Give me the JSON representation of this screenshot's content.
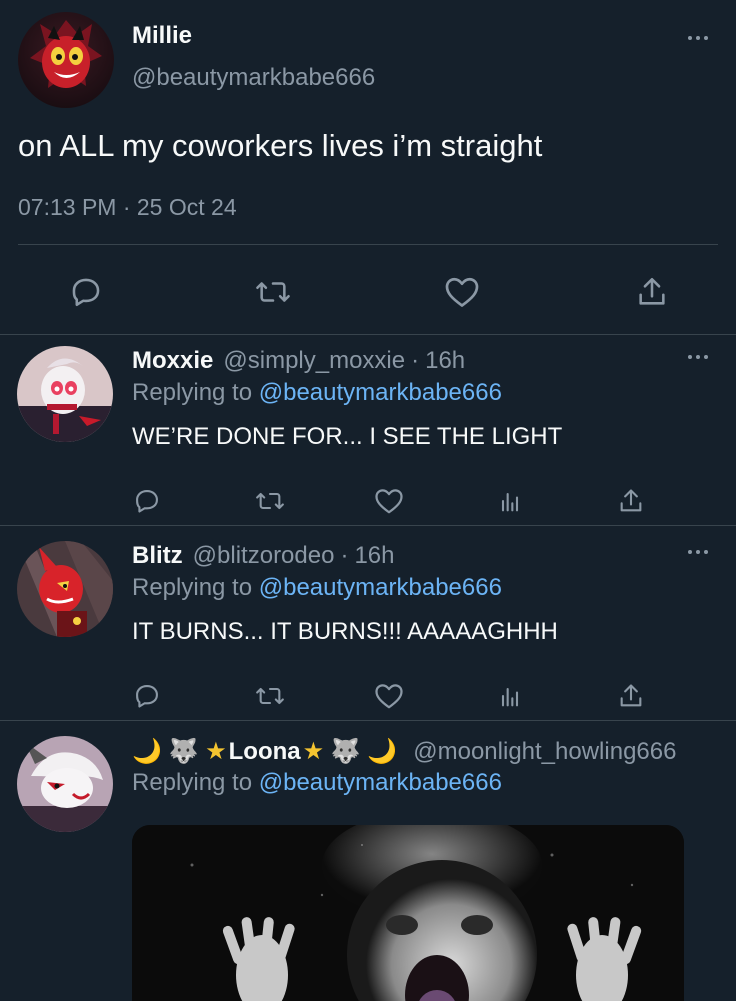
{
  "main_tweet": {
    "name": "Millie",
    "handle": "@beautymarkbabe666",
    "text": "on ALL my coworkers lives i’m straight",
    "timestamp": "07:13 PM · 25 Oct 24",
    "actions": [
      "reply-icon",
      "retweet-icon",
      "like-icon",
      "share-icon"
    ]
  },
  "replies": [
    {
      "name": "Moxxie",
      "handle": "@simply_moxxie",
      "separator": "·",
      "time": "16h",
      "replying_prefix": "Replying to",
      "replying_to": "@beautymarkbabe666",
      "text": "WE’RE DONE FOR... I SEE THE LIGHT"
    },
    {
      "name": "Blitz",
      "handle": "@blitzorodeo",
      "separator": "·",
      "time": "16h",
      "replying_prefix": "Replying to",
      "replying_to": "@beautymarkbabe666",
      "text": "IT BURNS... IT BURNS!!! AAAAAGHHH"
    },
    {
      "name_prefix": "🌙 🐺 ★",
      "name": "Loona",
      "name_suffix": "★ 🐺 🌙",
      "handle": "@moonlight_howling666",
      "replying_prefix": "Replying to",
      "replying_to": "@beautymarkbabe666",
      "media": "black-and-white photo of a screaming figure"
    }
  ],
  "colors": {
    "background": "#15202b",
    "text": "#f7f9f9",
    "secondary": "#8b98a5",
    "link": "#6cb4f5",
    "divider": "#38444d"
  }
}
